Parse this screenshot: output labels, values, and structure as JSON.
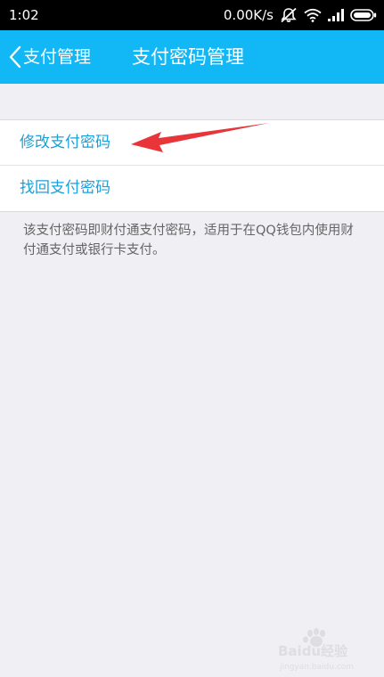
{
  "status_bar": {
    "time": "1:02",
    "speed": "0.00K/s"
  },
  "nav": {
    "back_label": "支付管理",
    "title": "支付密码管理"
  },
  "list": {
    "items": [
      {
        "label": "修改支付密码"
      },
      {
        "label": "找回支付密码"
      }
    ]
  },
  "note": "该支付密码即财付通支付密码，适用于在QQ钱包内使用财付通支付或银行卡支付。",
  "watermark": {
    "text": "Baidu经验",
    "domain": "jingyan.baidu.com"
  },
  "colors": {
    "nav_bar": "#12b7f5",
    "link_text": "#1aa0db",
    "annotation_arrow": "#e8353a",
    "background": "#efeff4"
  },
  "icons": [
    "back-chevron-icon",
    "mute-icon",
    "wifi-icon",
    "signal-icon",
    "battery-icon",
    "paw-logo-icon",
    "annotation-arrow"
  ]
}
